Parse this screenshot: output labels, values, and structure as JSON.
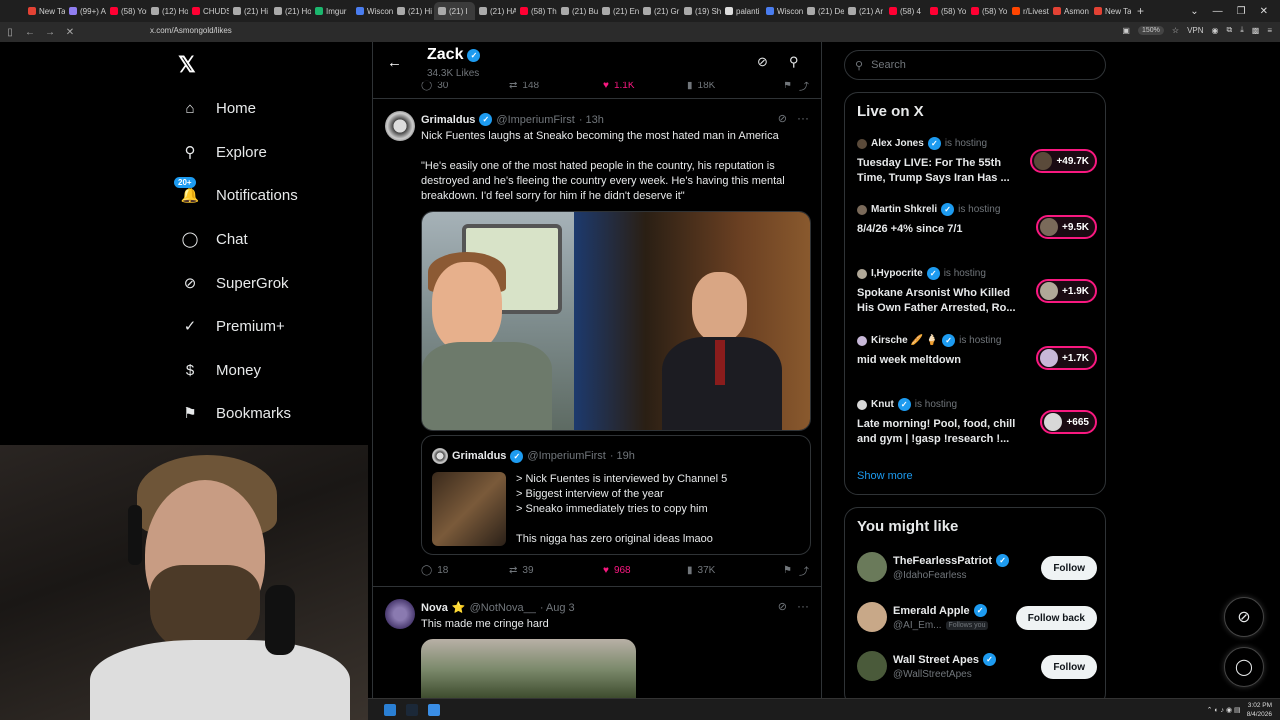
{
  "browser": {
    "tabs": [
      {
        "label": "New Tab",
        "color": "#e34234"
      },
      {
        "label": "(99+) Atl",
        "color": "#8f7df0"
      },
      {
        "label": "(58) You",
        "color": "#ff0033"
      },
      {
        "label": "(12) Ho",
        "color": "#aaaaaa"
      },
      {
        "label": "CHUDS",
        "color": "#ff0033"
      },
      {
        "label": "(21) Hi",
        "color": "#aaaaaa"
      },
      {
        "label": "(21) Ho",
        "color": "#aaaaaa"
      },
      {
        "label": "Imgur",
        "color": "#1bb76e"
      },
      {
        "label": "Wiscon",
        "color": "#4a7df0"
      },
      {
        "label": "(21) Hi",
        "color": "#aaaaaa"
      },
      {
        "label": "(21) I",
        "color": "#aaaaaa",
        "active": true
      },
      {
        "label": "(21) HA",
        "color": "#aaaaaa"
      },
      {
        "label": "(58) Th",
        "color": "#ff0033"
      },
      {
        "label": "(21) Bu",
        "color": "#aaaaaa"
      },
      {
        "label": "(21) En",
        "color": "#aaaaaa"
      },
      {
        "label": "(21) Gr",
        "color": "#aaaaaa"
      },
      {
        "label": "(19) Sh",
        "color": "#aaaaaa"
      },
      {
        "label": "palanti",
        "color": "#dddddd"
      },
      {
        "label": "Wiscon",
        "color": "#4a7df0"
      },
      {
        "label": "(21) De",
        "color": "#aaaaaa"
      },
      {
        "label": "(21) Ar",
        "color": "#aaaaaa"
      },
      {
        "label": "(58) 4",
        "color": "#ff0033"
      },
      {
        "label": "(58) Yo",
        "color": "#ff0033"
      },
      {
        "label": "(58) Yo",
        "color": "#ff0033"
      },
      {
        "label": "r/Livest",
        "color": "#ff4500"
      },
      {
        "label": "Asmon",
        "color": "#e34234"
      },
      {
        "label": "New Ta",
        "color": "#e34234"
      }
    ],
    "url": "x.com/Asmongold/likes",
    "zoom": "150%",
    "vpn_label": "VPN"
  },
  "sidebar": {
    "logo": "𝕏",
    "items": [
      {
        "label": "Home",
        "icon": "home-icon",
        "glyph": "⌂"
      },
      {
        "label": "Explore",
        "icon": "search-icon",
        "glyph": "⚲"
      },
      {
        "label": "Notifications",
        "icon": "bell-icon",
        "glyph": "🔔",
        "badge": "20+"
      },
      {
        "label": "Chat",
        "icon": "chat-icon",
        "glyph": "◯"
      },
      {
        "label": "SuperGrok",
        "icon": "grok-icon",
        "glyph": "⊘"
      },
      {
        "label": "Premium+",
        "icon": "premium-icon",
        "glyph": "✓"
      },
      {
        "label": "Money",
        "icon": "money-icon",
        "glyph": "$"
      },
      {
        "label": "Bookmarks",
        "icon": "bookmark-icon",
        "glyph": "⚑"
      }
    ]
  },
  "header": {
    "name": "Zack",
    "likes_count": "34.3K Likes"
  },
  "prev_tweet_actions": {
    "replies": "30",
    "reposts": "148",
    "likes": "1.1K",
    "views": "18K"
  },
  "tweet1": {
    "name": "Grimaldus",
    "handle": "@ImperiumFirst",
    "time": "· 13h",
    "line1": "Nick Fuentes laughs at Sneako becoming the most hated man in America",
    "line2": "\"He's easily one of the most hated people in the country, his reputation is destroyed and he's fleeing the country every week. He's having this mental breakdown. I'd feel sorry for him if he didn't deserve it\"",
    "quote": {
      "name": "Grimaldus",
      "handle": "@ImperiumFirst",
      "time": "· 19h",
      "lines": [
        "> Nick Fuentes is interviewed by Channel 5",
        "> Biggest interview of the year",
        "> Sneako immediately tries to copy him",
        "",
        "This nigga has zero original ideas lmaoo"
      ]
    },
    "replies": "18",
    "reposts": "39",
    "likes": "968",
    "views": "37K"
  },
  "tweet2": {
    "name": "Nova",
    "star": "⭐",
    "handle": "@NotNova__",
    "time": "· Aug 3",
    "text": "This made me cringe hard"
  },
  "right": {
    "search_placeholder": "Search",
    "live_title": "Live on X",
    "live": [
      {
        "host": "Alex Jones",
        "title": "Tuesday LIVE: For The 55th Time, Trump Says Iran Has ...",
        "count": "+49.7K"
      },
      {
        "host": "Martin Shkreli",
        "title": "8/4/26 +4% since 7/1",
        "count": "+9.5K"
      },
      {
        "host": "I,Hypocrite",
        "title": "Spokane Arsonist Who Killed His Own Father Arrested, Ro...",
        "count": "+1.9K"
      },
      {
        "host": "Kirsche 🥖 🍦",
        "title": "mid week meltdown",
        "count": "+1.7K"
      },
      {
        "host": "Knut",
        "title": "Late morning! Pool, food, chill and gym | !gasp !research !...",
        "count": "+665"
      }
    ],
    "is_hosting": "is hosting",
    "show_more": "Show more",
    "follow_title": "You might like",
    "follow": [
      {
        "name": "TheFearlessPatriot",
        "handle": "@IdahoFearless",
        "button": "Follow",
        "follows_you": ""
      },
      {
        "name": "Emerald Apple",
        "handle": "@AI_Em...",
        "button": "Follow back",
        "follows_you": "Follows you"
      },
      {
        "name": "Wall Street Apes",
        "handle": "@WallStreetApes",
        "button": "Follow",
        "follows_you": ""
      }
    ]
  },
  "taskbar": {
    "time": "3:02 PM",
    "date": "8/4/2026"
  },
  "colors": {
    "accent": "#1d9bf0",
    "like": "#f91880",
    "live_border": "#f91880"
  }
}
